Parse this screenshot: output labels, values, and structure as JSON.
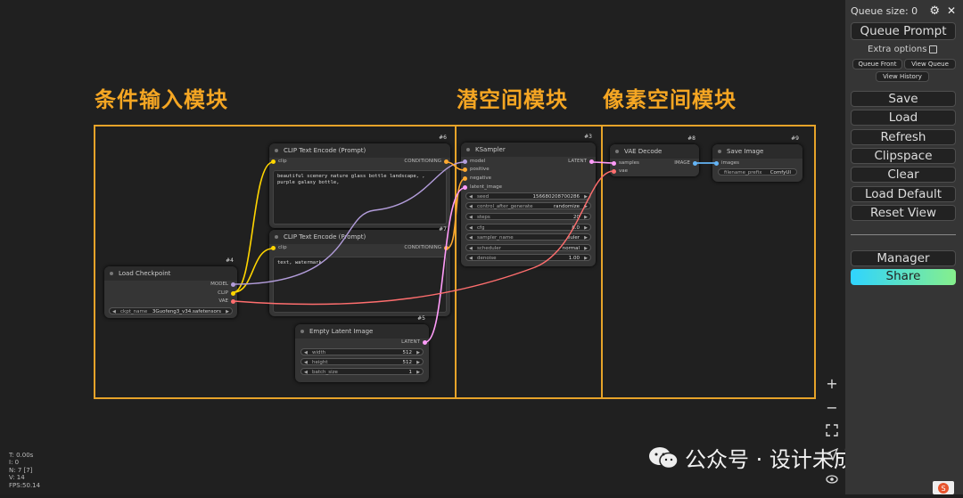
{
  "sections": {
    "input": "条件输入模块",
    "latent": "潜空间模块",
    "pixel": "像素空间模块"
  },
  "nodes": {
    "clip1": {
      "title": "CLIP Text Encode (Prompt)",
      "id": "#6",
      "input": "clip",
      "output": "CONDITIONING",
      "text": "beautiful scenery nature glass bottle landscape, , purple galaxy bottle,"
    },
    "clip2": {
      "title": "CLIP Text Encode (Prompt)",
      "id": "#7",
      "input": "clip",
      "output": "CONDITIONING",
      "text": "text, watermark"
    },
    "ckpt": {
      "title": "Load Checkpoint",
      "id": "#4",
      "outputs": [
        "MODEL",
        "CLIP",
        "VAE"
      ],
      "widget_label": "ckpt_name",
      "widget_value": "3Guofeng3_v34.safetensors"
    },
    "latent": {
      "title": "Empty Latent Image",
      "id": "#5",
      "output": "LATENT",
      "widgets": [
        {
          "label": "width",
          "value": "512"
        },
        {
          "label": "height",
          "value": "512"
        },
        {
          "label": "batch_size",
          "value": "1"
        }
      ]
    },
    "ksampler": {
      "title": "KSampler",
      "id": "#3",
      "inputs": [
        "model",
        "positive",
        "negative",
        "latent_image"
      ],
      "output": "LATENT",
      "widgets": [
        {
          "label": "seed",
          "value": "156680208700286"
        },
        {
          "label": "control_after_generate",
          "value": "randomize"
        },
        {
          "label": "steps",
          "value": "20"
        },
        {
          "label": "cfg",
          "value": "8.0"
        },
        {
          "label": "sampler_name",
          "value": "euler"
        },
        {
          "label": "scheduler",
          "value": "normal"
        },
        {
          "label": "denoise",
          "value": "1.00"
        }
      ]
    },
    "vae": {
      "title": "VAE Decode",
      "id": "#8",
      "inputs": [
        "samples",
        "vae"
      ],
      "output": "IMAGE"
    },
    "save": {
      "title": "Save Image",
      "id": "#9",
      "input": "images",
      "widget_label": "filename_prefix",
      "widget_value": "ComfyUI"
    }
  },
  "stats": [
    "T: 0.00s",
    "I: 0",
    "N: 7 [7]",
    "V: 14",
    "FPS:50.14"
  ],
  "watermark": "公众号 · 设计未成师",
  "menu": {
    "queue_size": "Queue size: 0",
    "queue_prompt": "Queue Prompt",
    "extra_options": "Extra options",
    "queue_front": "Queue Front",
    "view_queue": "View Queue",
    "view_history": "View History",
    "save": "Save",
    "load": "Load",
    "refresh": "Refresh",
    "clipspace": "Clipspace",
    "clear": "Clear",
    "load_default": "Load Default",
    "reset_view": "Reset View",
    "manager": "Manager",
    "share": "Share"
  },
  "colors": {
    "section": "#f5a623",
    "clip_wire": "#ffd500",
    "model_wire": "#b39ddb",
    "conditioning_wire": "#ffa931",
    "latent_wire": "#ff9cf9",
    "vae_wire": "#ff6e6e",
    "image_wire": "#64b5f6"
  },
  "canvas_tools": [
    "zoom-in-icon",
    "zoom-out-icon",
    "fit-view-icon",
    "locate-icon",
    "eye-icon"
  ]
}
